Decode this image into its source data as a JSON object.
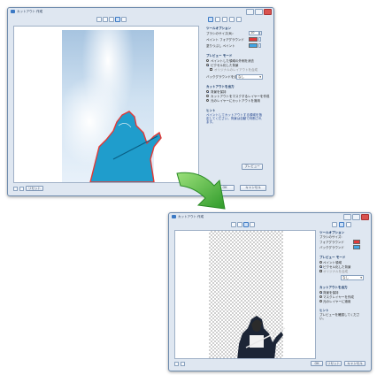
{
  "win1": {
    "title": "カットアウト 作成",
    "panel": {
      "section_tool": "ツールオプション",
      "brush_label": "ブラシのサイズ(B):",
      "brush_value": "10",
      "fg_label": "ペイント フォアグラウンド",
      "bg_label": "塗りつぶし ペイント",
      "section_mode": "プレビュー モード",
      "mode_opt1": "ペイントした領域の外側を消去",
      "mode_opt2": "ピクセル化した背景",
      "mode_opt3": "オリジナルのレイアウトを合成",
      "mode_select_label": "バックグラウンドを合成:",
      "mode_select_value": "なし",
      "section_output": "カットアウトを出力",
      "out_opt1": "背景を保持",
      "out_opt2": "カットアウトをマスクするレイヤーを作成",
      "out_opt3": "元のレイヤーにカットアウトを適用",
      "section_hint": "ヒント",
      "hint_text": "ペイントしてカットアウトする領域を指定してください。背景は自動で判断されます。",
      "preview_button": "プレビュー"
    },
    "bottom": {
      "cancel_label": "キャンセル",
      "ok_label": "OK",
      "other_label": "リセット"
    }
  },
  "win2": {
    "title": "カットアウト 作成",
    "panel": {
      "section_tool": "ツールオプション",
      "brush_label": "ブラシのサイズ:",
      "fg_label": "フォアグラウンド",
      "bg_label": "バックグラウンド",
      "section_mode": "プレビュー モード",
      "mode_opt1": "ペイント領域",
      "mode_opt2": "ピクセル化した背景",
      "mode_opt3": "オリジナルを合成",
      "mode_select_value": "なし",
      "section_output": "カットアウトを出力",
      "out_opt1": "背景を保持",
      "out_opt2": "マスクレイヤーを作成",
      "out_opt3": "元のレイヤーに適用",
      "section_hint": "ヒント",
      "hint_text": "プレビューを確認してください。"
    },
    "bottom": {
      "ok_label": "OK",
      "cancel_label": "キャンセル",
      "other_label": "リセット"
    }
  },
  "colors": {
    "accent": "#3b79c4",
    "fg_swatch": "#e03a3a",
    "bg_swatch": "#3fa6e6",
    "arrow": "#3fae3a",
    "selection": "#1f9dcc"
  }
}
